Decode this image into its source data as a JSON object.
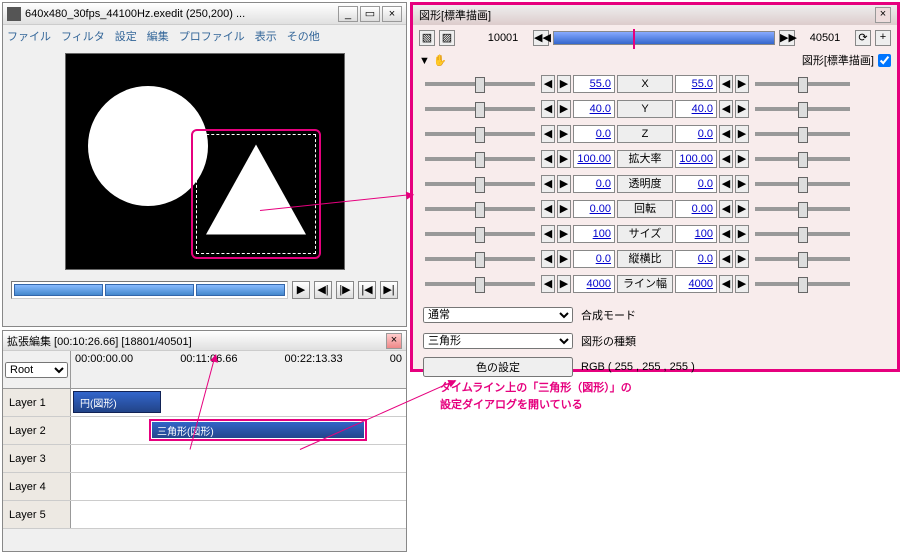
{
  "main": {
    "title": "640x480_30fps_44100Hz.exedit (250,200) ...",
    "menus": [
      "ファイル",
      "フィルタ",
      "設定",
      "編集",
      "プロファイル",
      "表示",
      "その他"
    ],
    "transport": {
      "play": "▶",
      "prev": "◀|",
      "next": "|▶",
      "first": "|◀",
      "last": "▶|"
    }
  },
  "timeline": {
    "title": "拡張編集 [00:10:26.66] [18801/40501]",
    "root": "Root",
    "ruler": [
      "00:00:00.00",
      "00:11:06.66",
      "00:22:13.33",
      "00"
    ],
    "layers": [
      "Layer 1",
      "Layer 2",
      "Layer 3",
      "Layer 4",
      "Layer 5"
    ],
    "clips": {
      "circle": "円(図形)",
      "triangle": "三角形(図形)"
    }
  },
  "props": {
    "title": "図形[標準描画]",
    "frame_start": "10001",
    "frame_end": "40501",
    "subtitle": "図形[標準描画]",
    "rows": [
      {
        "label": "X",
        "l": "55.0",
        "r": "55.0"
      },
      {
        "label": "Y",
        "l": "40.0",
        "r": "40.0"
      },
      {
        "label": "Z",
        "l": "0.0",
        "r": "0.0"
      },
      {
        "label": "拡大率",
        "l": "100.00",
        "r": "100.00"
      },
      {
        "label": "透明度",
        "l": "0.0",
        "r": "0.0"
      },
      {
        "label": "回転",
        "l": "0.00",
        "r": "0.00"
      },
      {
        "label": "サイズ",
        "l": "100",
        "r": "100"
      },
      {
        "label": "縦横比",
        "l": "0.0",
        "r": "0.0"
      },
      {
        "label": "ライン幅",
        "l": "4000",
        "r": "4000"
      }
    ],
    "blend_mode": "通常",
    "blend_label": "合成モード",
    "shape_type": "三角形",
    "shape_label": "図形の種類",
    "color_btn": "色の設定",
    "color_value": "RGB ( 255 , 255 , 255 )"
  },
  "callout": {
    "line1": "タイムライン上の「三角形（図形）」の",
    "line2": "設定ダイアログを開いている"
  }
}
